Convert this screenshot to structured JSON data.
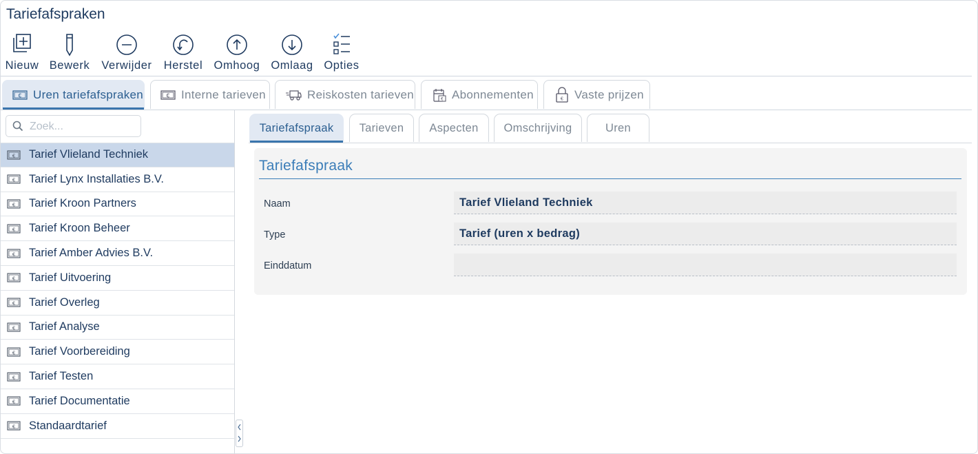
{
  "window": {
    "title": "Tariefafspraken"
  },
  "toolbar": {
    "new_label": "Nieuw",
    "edit_label": "Bewerk",
    "delete_label": "Verwijder",
    "restore_label": "Herstel",
    "up_label": "Omhoog",
    "down_label": "Omlaag",
    "options_label": "Opties"
  },
  "main_tabs": [
    {
      "label": "Uren tariefafspraken",
      "icon": "money-icon",
      "active": true
    },
    {
      "label": "Interne tarieven",
      "icon": "money-icon",
      "active": false
    },
    {
      "label": "Reiskosten tarieven",
      "icon": "truck-icon",
      "active": false
    },
    {
      "label": "Abonnementen",
      "icon": "calendar-icon",
      "active": false
    },
    {
      "label": "Vaste prijzen",
      "icon": "lock-icon",
      "active": false
    }
  ],
  "search": {
    "placeholder": "Zoek...",
    "value": ""
  },
  "tariff_list": [
    "Tarief Vlieland Techniek",
    "Tarief Lynx Installaties B.V.",
    "Tarief Kroon Partners",
    "Tarief Kroon Beheer",
    "Tarief Amber Advies B.V.",
    "Tarief Uitvoering",
    "Tarief Overleg",
    "Tarief Analyse",
    "Tarief Voorbereiding",
    "Tarief Testen",
    "Tarief Documentatie",
    "Standaardtarief"
  ],
  "selected_index": 0,
  "sub_tabs": [
    {
      "label": "Tariefafspraak",
      "active": true
    },
    {
      "label": "Tarieven",
      "active": false
    },
    {
      "label": "Aspecten",
      "active": false
    },
    {
      "label": "Omschrijving",
      "active": false
    },
    {
      "label": "Uren",
      "active": false
    }
  ],
  "detail": {
    "heading": "Tariefafspraak",
    "fields": {
      "name_label": "Naam",
      "name_value": "Tarief Vlieland Techniek",
      "type_label": "Type",
      "type_value": "Tarief (uren x bedrag)",
      "enddate_label": "Einddatum",
      "enddate_value": ""
    }
  },
  "colors": {
    "accent": "#3b7db8",
    "active_tab_bg": "#e2e9f3",
    "selected_row": "#c9d7ea",
    "text": "#1e3a5f"
  }
}
